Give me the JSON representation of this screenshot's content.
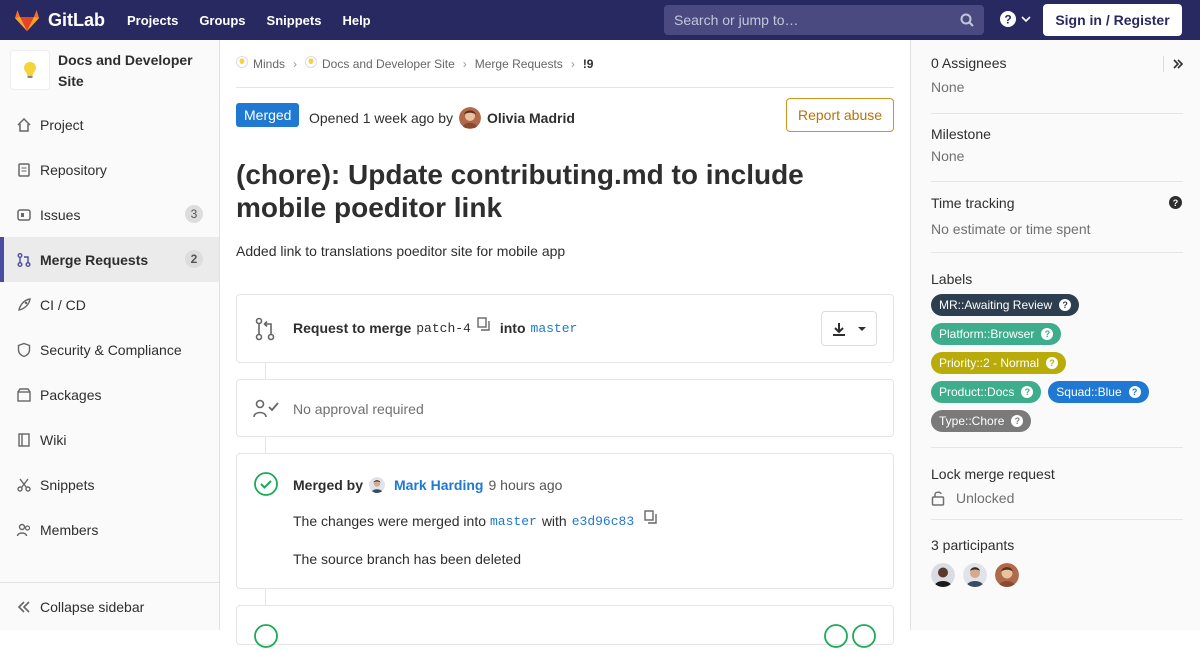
{
  "topbar": {
    "brand": "GitLab",
    "nav": [
      "Projects",
      "Groups",
      "Snippets",
      "Help"
    ],
    "search_placeholder": "Search or jump to…",
    "signin": "Sign in / Register"
  },
  "sidebar": {
    "project_name": "Docs and Developer Site",
    "items": [
      {
        "label": "Project",
        "icon": "home-icon"
      },
      {
        "label": "Repository",
        "icon": "doc-icon"
      },
      {
        "label": "Issues",
        "icon": "issues-icon",
        "count": "3"
      },
      {
        "label": "Merge Requests",
        "icon": "merge-request-icon",
        "count": "2",
        "active": true
      },
      {
        "label": "CI / CD",
        "icon": "rocket-icon"
      },
      {
        "label": "Security & Compliance",
        "icon": "shield-icon"
      },
      {
        "label": "Packages",
        "icon": "package-icon"
      },
      {
        "label": "Wiki",
        "icon": "book-icon"
      },
      {
        "label": "Snippets",
        "icon": "scissors-icon"
      },
      {
        "label": "Members",
        "icon": "users-icon"
      }
    ],
    "collapse": "Collapse sidebar"
  },
  "breadcrumb": [
    "Minds",
    "Docs and Developer Site",
    "Merge Requests",
    "!9"
  ],
  "mr": {
    "status": "Merged",
    "opened_text": "Opened 1 week ago by",
    "author": "Olivia Madrid",
    "report": "Report abuse",
    "title": "(chore): Update contributing.md to include mobile poeditor link",
    "description": "Added link to translations poeditor site for mobile app",
    "request_label": "Request to merge",
    "source_branch": "patch-4",
    "into": "into",
    "target_branch": "master",
    "approval": "No approval required",
    "merged_by_label": "Merged by",
    "merged_by": "Mark Harding",
    "merged_time": "9 hours ago",
    "merged_into_text": "The changes were merged into",
    "merged_with": "with",
    "commit": "e3d96c83",
    "branch_deleted": "The source branch has been deleted"
  },
  "rightbar": {
    "assignees_title": "0 Assignees",
    "assignees_value": "None",
    "milestone_title": "Milestone",
    "milestone_value": "None",
    "time_title": "Time tracking",
    "time_value": "No estimate or time spent",
    "labels_title": "Labels",
    "labels": [
      {
        "text": "MR::Awaiting Review",
        "color": "#2d3e50"
      },
      {
        "text": "Platform::Browser",
        "color": "#3dad8c"
      },
      {
        "text": "Priority::2 - Normal",
        "color": "#b9ac0a"
      },
      {
        "text": "Product::Docs",
        "color": "#3dad8c"
      },
      {
        "text": "Squad::Blue",
        "color": "#1f78d1"
      },
      {
        "text": "Type::Chore",
        "color": "#7a7a7a"
      }
    ],
    "lock_title": "Lock merge request",
    "lock_value": "Unlocked",
    "participants_title": "3 participants"
  }
}
